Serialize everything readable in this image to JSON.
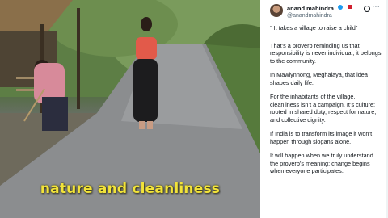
{
  "video": {
    "caption": "nature and cleanliness"
  },
  "tweet": {
    "author": {
      "display_name": "anand mahindra",
      "handle": "@anandmahindra"
    },
    "icons": {
      "verified": "verified-badge-icon",
      "flag": "flag-icon",
      "grok": "grok-icon",
      "more": "more-options-icon"
    },
    "paragraphs": [
      "“ It takes a village to raise a child”",
      "That’s a proverb reminding us that responsibility is never individual; it belongs to the community.",
      "In Mawlynnong, Meghalaya, that idea shapes daily life.",
      "For the inhabitants of the village, cleanliness isn’t a campaign. It’s culture; rooted in shared duty, respect for nature, and collective dignity.",
      "If India is to transform its image it won’t happen through slogans alone.",
      "It will happen when we truly understand the proverb’s meaning: change begins when everyone participates."
    ],
    "accent_color": "#1d9bf0"
  }
}
